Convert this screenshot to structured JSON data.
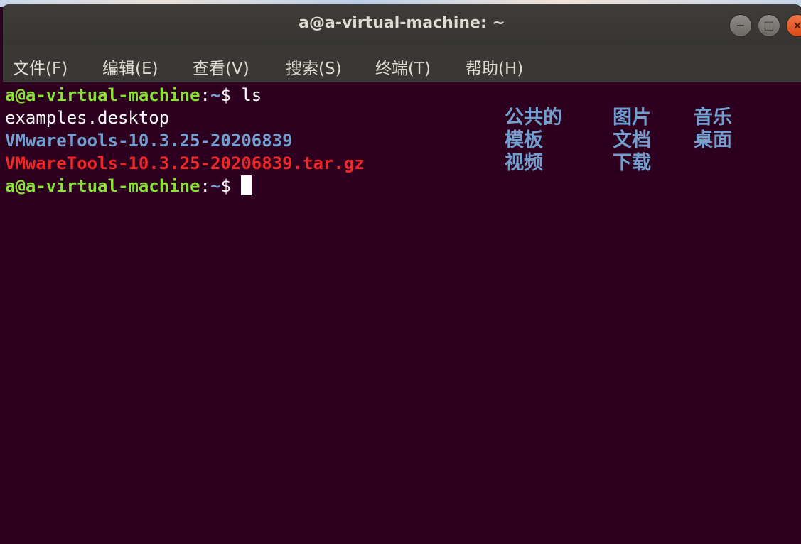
{
  "window": {
    "title": "a@a-virtual-machine: ~",
    "minimize_icon": "minimize-icon",
    "maximize_icon": "maximize-icon",
    "close_icon": "close-icon"
  },
  "menubar": {
    "items": [
      "文件(F)",
      "编辑(E)",
      "查看(V)",
      "搜索(S)",
      "终端(T)",
      "帮助(H)"
    ]
  },
  "terminal": {
    "prompt_user": "a@a-virtual-machine",
    "prompt_colon": ":",
    "prompt_path": "~",
    "prompt_sign": "$ ",
    "command": "ls",
    "files": {
      "examples": "examples.desktop",
      "vmware_dir": "VMwareTools-10.3.25-20206839",
      "vmware_archive": "VMwareTools-10.3.25-20206839.tar.gz",
      "dirs": [
        "公共的",
        "图片",
        "音乐",
        "模板",
        "文档",
        "桌面",
        "视频",
        "下载"
      ]
    }
  },
  "colors": {
    "terminal_bg": "#2c001e",
    "prompt_user": "#8ae234",
    "directory": "#729fcf",
    "archive": "#ef2929",
    "text": "#ffffff",
    "titlebar": "#3c3b37",
    "close_button": "#dd4814"
  }
}
